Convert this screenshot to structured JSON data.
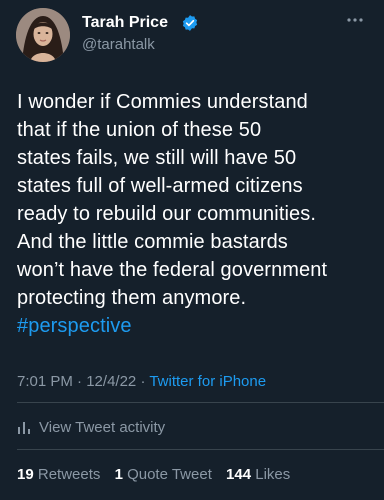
{
  "author": {
    "display_name": "Tarah Price",
    "handle": "@tarahtalk",
    "verified": true
  },
  "tweet": {
    "text": "I wonder if Commies understand\nthat if the union of these 50\nstates fails, we still will have 50\nstates full of well-armed citizens\nready to rebuild our communities.\nAnd the little commie bastards\nwon’t have the federal government\nprotecting them anymore.",
    "hashtag": "#perspective"
  },
  "meta": {
    "time": "7:01 PM",
    "separator": "·",
    "date": "12/4/22",
    "source": "Twitter for iPhone"
  },
  "activity": {
    "label": "View Tweet activity"
  },
  "stats": {
    "retweets_count": "19",
    "retweets_label": "Retweets",
    "quotes_count": "1",
    "quotes_label": "Quote Tweet",
    "likes_count": "144",
    "likes_label": "Likes"
  },
  "colors": {
    "background": "#15202b",
    "accent": "#1d9bf0",
    "secondary_text": "#8b98a5"
  },
  "icons": [
    "avatar-photo",
    "verified-badge-icon",
    "more-options-icon",
    "analytics-icon"
  ]
}
